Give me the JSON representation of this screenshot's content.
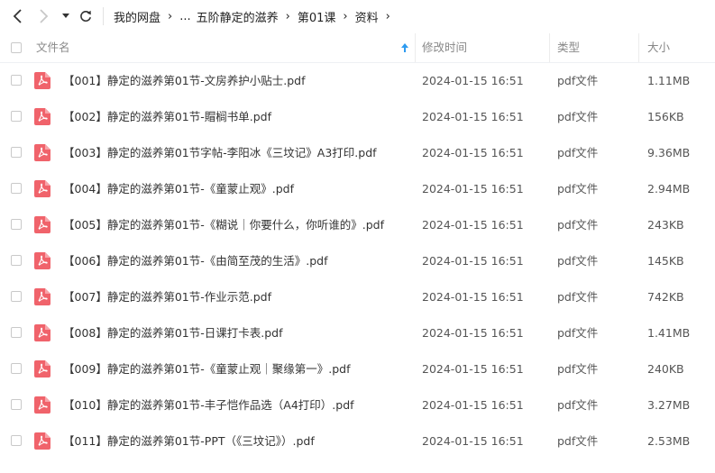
{
  "breadcrumb": [
    "我的网盘",
    "...",
    "五阶静定的滋养",
    "第01课",
    "资料"
  ],
  "columns": {
    "name": "文件名",
    "modified": "修改时间",
    "type": "类型",
    "size": "大小"
  },
  "files": [
    {
      "name": "【001】静定的滋养第01节-文房养护小贴士.pdf",
      "modified": "2024-01-15 16:51",
      "type": "pdf文件",
      "size": "1.11MB"
    },
    {
      "name": "【002】静定的滋养第01节-賵榈书单.pdf",
      "modified": "2024-01-15 16:51",
      "type": "pdf文件",
      "size": "156KB"
    },
    {
      "name": "【003】静定的滋养第01节字帖-李阳冰《三坟记》A3打印.pdf",
      "modified": "2024-01-15 16:51",
      "type": "pdf文件",
      "size": "9.36MB"
    },
    {
      "name": "【004】静定的滋养第01节-《童蒙止观》.pdf",
      "modified": "2024-01-15 16:51",
      "type": "pdf文件",
      "size": "2.94MB"
    },
    {
      "name": "【005】静定的滋养第01节-《糊说｜你要什么，你听谁的》.pdf",
      "modified": "2024-01-15 16:51",
      "type": "pdf文件",
      "size": "243KB"
    },
    {
      "name": "【006】静定的滋养第01节-《由简至茂的生活》.pdf",
      "modified": "2024-01-15 16:51",
      "type": "pdf文件",
      "size": "145KB"
    },
    {
      "name": "【007】静定的滋养第01节-作业示范.pdf",
      "modified": "2024-01-15 16:51",
      "type": "pdf文件",
      "size": "742KB"
    },
    {
      "name": "【008】静定的滋养第01节-日课打卡表.pdf",
      "modified": "2024-01-15 16:51",
      "type": "pdf文件",
      "size": "1.41MB"
    },
    {
      "name": "【009】静定的滋养第01节-《童蒙止观｜聚缘第一》.pdf",
      "modified": "2024-01-15 16:51",
      "type": "pdf文件",
      "size": "240KB"
    },
    {
      "name": "【010】静定的滋养第01节-丰子恺作品选（A4打印）.pdf",
      "modified": "2024-01-15 16:51",
      "type": "pdf文件",
      "size": "3.27MB"
    },
    {
      "name": "【011】静定的滋养第01节-PPT（《三坟记》）.pdf",
      "modified": "2024-01-15 16:51",
      "type": "pdf文件",
      "size": "2.53MB"
    }
  ],
  "icons": {
    "back": "chevron-left-icon",
    "forward": "chevron-right-icon",
    "history": "caret-down-icon",
    "refresh": "refresh-icon",
    "sort": "sort-ascending-icon",
    "file": "pdf-file-icon"
  },
  "colors": {
    "pdf_icon": "#f0636b",
    "sort_arrow": "#2e9bf0",
    "forward_disabled": "#c8c8c8"
  }
}
